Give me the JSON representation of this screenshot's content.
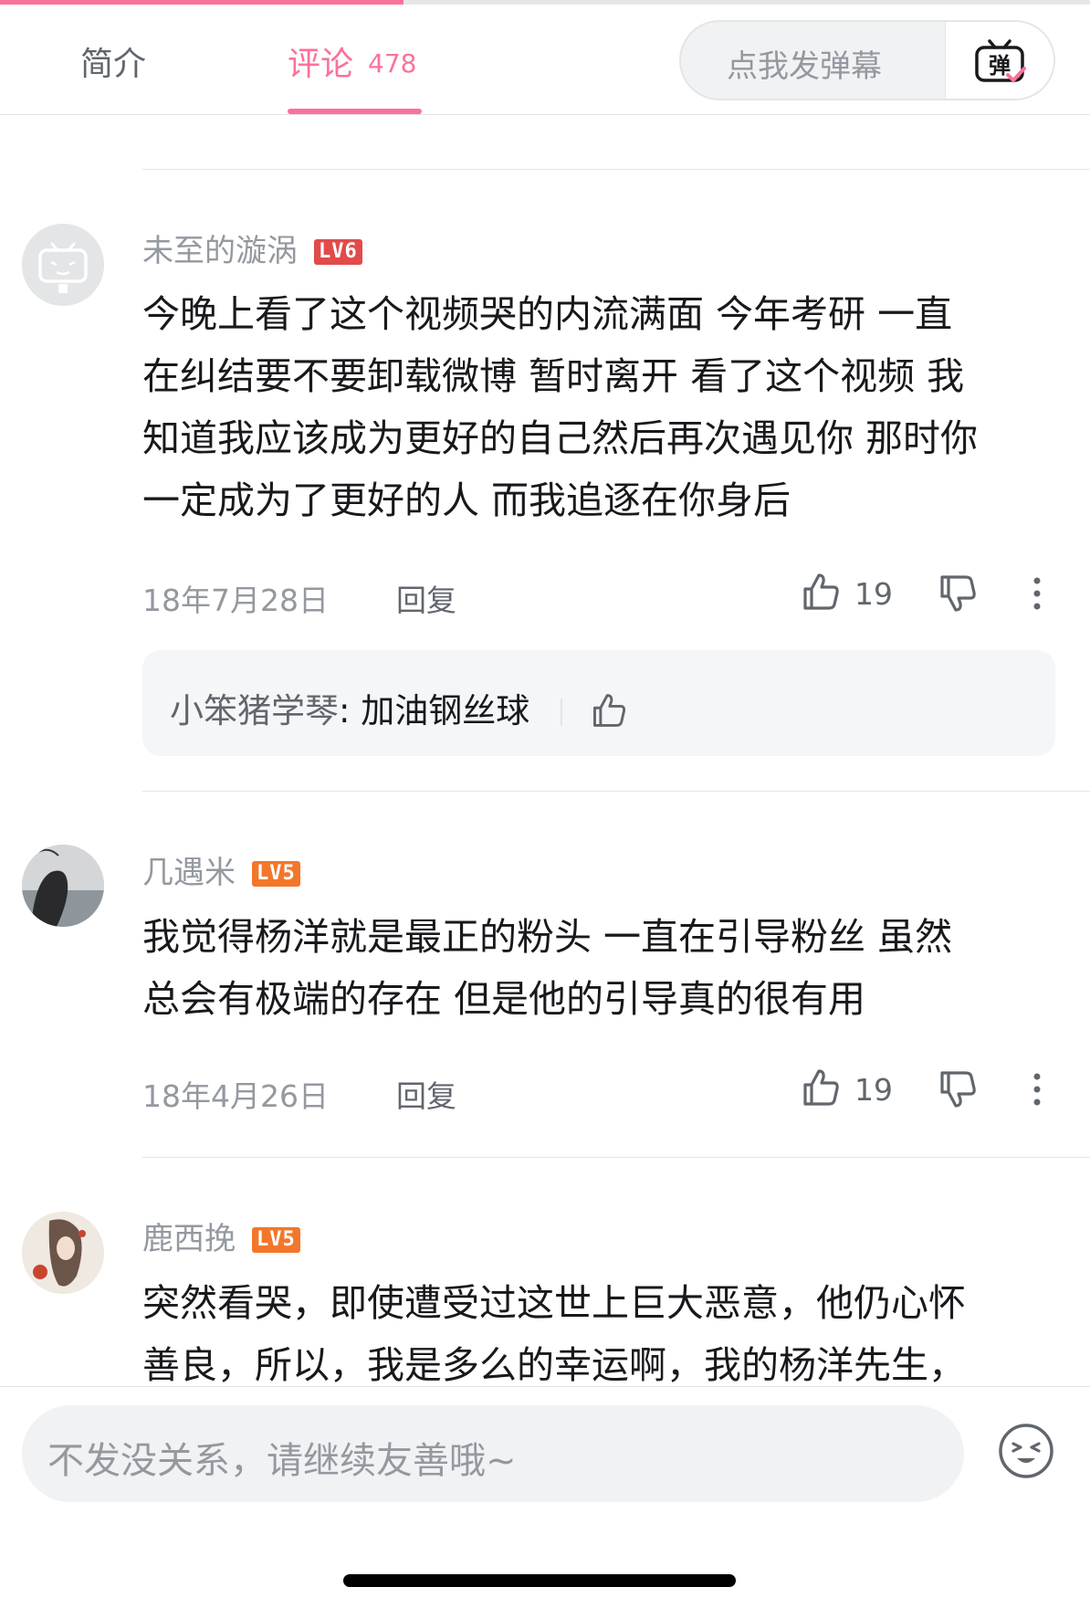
{
  "colors": {
    "accent": "#fb7299",
    "lv6": "#e14b4b",
    "lv5": "#f3772a"
  },
  "video_progress": 0.37,
  "tabs": {
    "intro": "简介",
    "comments": "评论",
    "comments_count": "478",
    "danmaku_placeholder": "点我发弹幕",
    "danmaku_icon": "弹"
  },
  "comments": [
    {
      "username": "未至的漩涡",
      "level": "LV6",
      "text_lines": [
        "今晚上看了这个视频哭的内流满面 今年考研 一直",
        "在纠结要不要卸载微博 暂时离开 看了这个视频 我",
        "知道我应该成为更好的自己然后再次遇见你 那时你",
        "一定成为了更好的人 而我追逐在你身后"
      ],
      "date": "18年7月28日",
      "reply_label": "回复",
      "likes": "19",
      "reply_preview": {
        "user": "小笨猪学琴",
        "colon": ":",
        "text": "加油钢丝球"
      }
    },
    {
      "username": "几遇米",
      "level": "LV5",
      "text_lines": [
        "我觉得杨洋就是最正的粉头 一直在引导粉丝 虽然",
        "总会有极端的存在 但是他的引导真的很有用"
      ],
      "date": "18年4月26日",
      "reply_label": "回复",
      "likes": "19"
    },
    {
      "username": "鹿西挽",
      "level": "LV5",
      "text_lines": [
        "突然看哭，即使遭受过这世上巨大恶意，他仍心怀",
        "善良，所以，我是多么的幸运啊，我的杨洋先生，"
      ]
    }
  ],
  "bottom": {
    "input_placeholder": "不发没关系，请继续友善哦~"
  }
}
